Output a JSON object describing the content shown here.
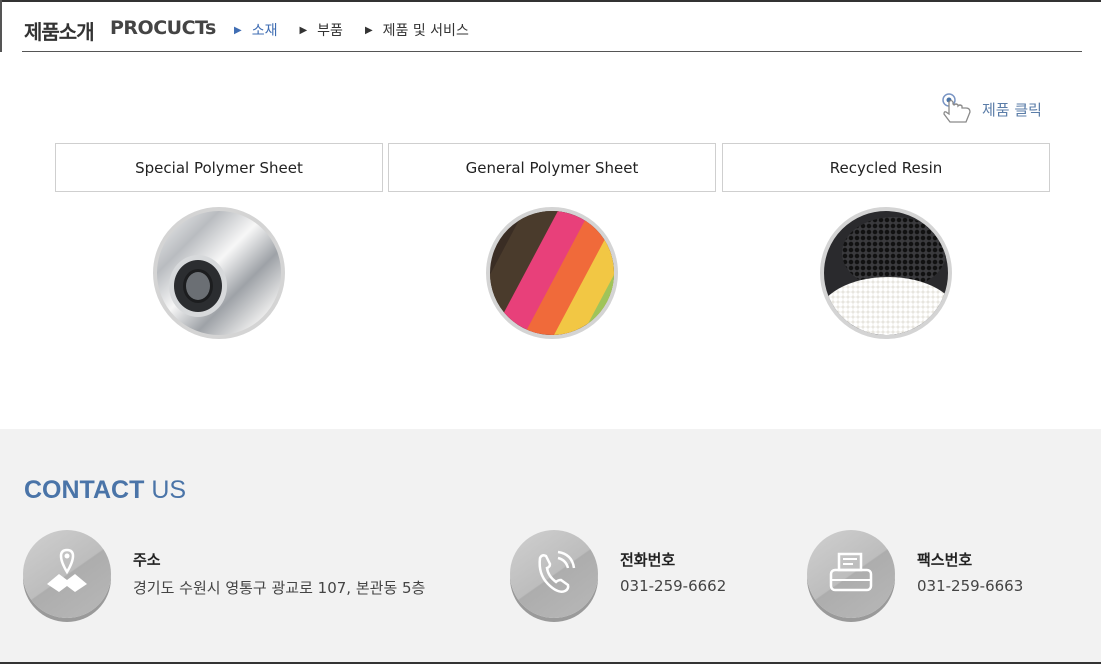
{
  "header": {
    "title_ko": "제품소개",
    "title_en": "PROCUCTs",
    "tabs": [
      {
        "label": "소재",
        "active": true
      },
      {
        "label": "부품",
        "active": false
      },
      {
        "label": "제품 및 서비스",
        "active": false
      }
    ]
  },
  "hint": {
    "label": "제품 클릭",
    "icon": "hand-pointer-icon"
  },
  "products": [
    {
      "label": "Special Polymer Sheet",
      "icon": "polymer-sheet-roll-image"
    },
    {
      "label": "General Polymer Sheet",
      "icon": "colored-fabric-sheets-image"
    },
    {
      "label": "Recycled Resin",
      "icon": "resin-pellets-image"
    }
  ],
  "contact": {
    "title_strong": "CONTACT",
    "title_light": "US",
    "items": [
      {
        "label": "주소",
        "value": "경기도 수원시 영통구 광교로 107, 본관동 5층",
        "icon": "map-pin-icon"
      },
      {
        "label": "전화번호",
        "value": "031-259-6662",
        "icon": "phone-icon"
      },
      {
        "label": "팩스번호",
        "value": "031-259-6663",
        "icon": "fax-icon"
      }
    ]
  },
  "colors": {
    "accent": "#3f6db3",
    "contact_blue": "#4a74a8",
    "footer_bg": "#f2f2f2"
  }
}
